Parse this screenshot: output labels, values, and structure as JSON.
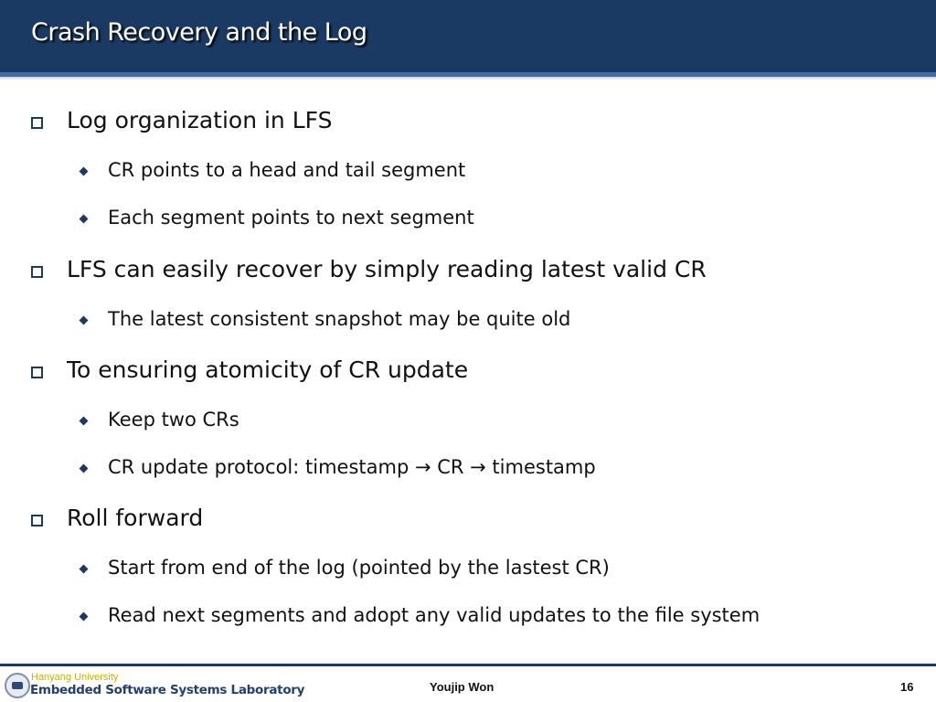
{
  "slide": {
    "title": "Crash Recovery and the Log",
    "bullets": [
      {
        "text": "Log organization in LFS",
        "sub": [
          "CR points to a head and tail segment",
          "Each segment points to next segment"
        ]
      },
      {
        "text": "LFS can easily recover by simply reading latest valid CR",
        "sub": [
          "The latest consistent snapshot may be quite old"
        ]
      },
      {
        "text": "To ensuring atomicity of CR update",
        "sub": [
          "Keep two CRs",
          "CR update protocol: timestamp → CR → timestamp"
        ]
      },
      {
        "text": "Roll forward",
        "sub": [
          "Start from end of the log (pointed by the lastest CR)",
          "Read next segments and adopt any valid updates to the file system"
        ]
      }
    ]
  },
  "footer": {
    "university": "Hanyang University",
    "lab": "Embedded Software Systems Laboratory",
    "author": "Youjip Won",
    "page_number": "16",
    "logo_icon": "university-seal-icon"
  },
  "colors": {
    "header_bg": "#1b3a63",
    "header_stripe": "#3f6ea5",
    "bullet": "#1b3a63",
    "university_text": "#c9b400",
    "lab_text": "#23406e"
  }
}
